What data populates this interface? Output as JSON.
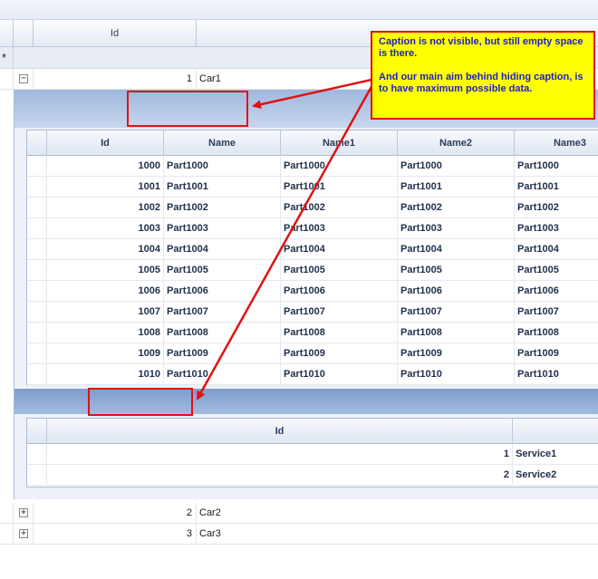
{
  "outer_grid": {
    "header": {
      "id_label": "Id"
    },
    "new_row_marker": "*",
    "rows": [
      {
        "expander": "⊟",
        "id": "1",
        "name": "Car1"
      },
      {
        "expander": "⊞",
        "id": "2",
        "name": "Car2"
      },
      {
        "expander": "⊞",
        "id": "3",
        "name": "Car3"
      }
    ]
  },
  "parts_grid": {
    "columns": [
      "Id",
      "Name",
      "Name1",
      "Name2",
      "Name3"
    ],
    "rows": [
      [
        "1000",
        "Part1000",
        "Part1000",
        "Part1000",
        "Part1000"
      ],
      [
        "1001",
        "Part1001",
        "Part1001",
        "Part1001",
        "Part1001"
      ],
      [
        "1002",
        "Part1002",
        "Part1002",
        "Part1002",
        "Part1002"
      ],
      [
        "1003",
        "Part1003",
        "Part1003",
        "Part1003",
        "Part1003"
      ],
      [
        "1004",
        "Part1004",
        "Part1004",
        "Part1004",
        "Part1004"
      ],
      [
        "1005",
        "Part1005",
        "Part1005",
        "Part1005",
        "Part1005"
      ],
      [
        "1006",
        "Part1006",
        "Part1006",
        "Part1006",
        "Part1006"
      ],
      [
        "1007",
        "Part1007",
        "Part1007",
        "Part1007",
        "Part1007"
      ],
      [
        "1008",
        "Part1008",
        "Part1008",
        "Part1008",
        "Part1008"
      ],
      [
        "1009",
        "Part1009",
        "Part1009",
        "Part1009",
        "Part1009"
      ],
      [
        "1010",
        "Part1010",
        "Part1010",
        "Part1010",
        "Part1010"
      ]
    ]
  },
  "services_grid": {
    "columns": [
      "Id"
    ],
    "rows": [
      [
        "1",
        "Service1"
      ],
      [
        "2",
        "Service2"
      ]
    ]
  },
  "annotation": {
    "line1": "Caption is not visible, but still empty space is there.",
    "line2": "And our main aim behind hiding caption, is to have maximum possible data.",
    "colors": {
      "note_bg": "#ffff00",
      "note_text": "#1d1dcc",
      "callout": "#e01212"
    }
  }
}
